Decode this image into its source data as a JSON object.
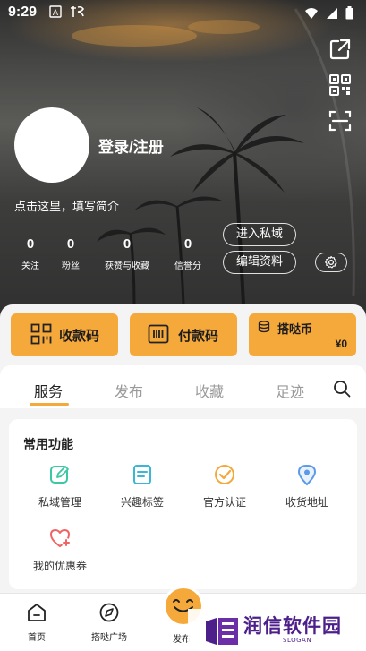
{
  "status_bar": {
    "time": "9:29"
  },
  "profile": {
    "login_label": "登录/注册",
    "bio_placeholder": "点击这里，填写简介"
  },
  "stats": [
    {
      "value": "0",
      "label": "关注"
    },
    {
      "value": "0",
      "label": "粉丝"
    },
    {
      "value": "0",
      "label": "获赞与收藏"
    },
    {
      "value": "0",
      "label": "信誉分"
    }
  ],
  "actions": {
    "private_domain": "进入私域",
    "edit_profile": "编辑资料"
  },
  "payments": {
    "receive": "收款码",
    "pay": "付款码",
    "coin_label": "搭哒币",
    "coin_balance": "¥0"
  },
  "tabs": [
    {
      "label": "服务",
      "active": true
    },
    {
      "label": "发布",
      "active": false
    },
    {
      "label": "收藏",
      "active": false
    },
    {
      "label": "足迹",
      "active": false
    }
  ],
  "common_functions": {
    "title": "常用功能",
    "items": [
      {
        "label": "私域管理",
        "icon": "edit-icon",
        "color": "#3cc8a5"
      },
      {
        "label": "兴趣标签",
        "icon": "tag-list-icon",
        "color": "#3bb6d6"
      },
      {
        "label": "官方认证",
        "icon": "verified-check-icon",
        "color": "#f3a83a"
      },
      {
        "label": "收货地址",
        "icon": "location-pin-icon",
        "color": "#5a9ae6"
      },
      {
        "label": "我的优惠券",
        "icon": "heart-plus-icon",
        "color": "#f06464"
      }
    ]
  },
  "bottom_nav": [
    {
      "label": "首页",
      "icon": "home-icon"
    },
    {
      "label": "搭哒广场",
      "icon": "plaza-icon"
    },
    {
      "label": "发布",
      "icon": "publish-icon"
    }
  ],
  "watermark": {
    "brand": "润信软件园",
    "slogan": "SLOGAN"
  },
  "colors": {
    "accent": "#f6a93b",
    "watermark": "#4c1f8a"
  }
}
